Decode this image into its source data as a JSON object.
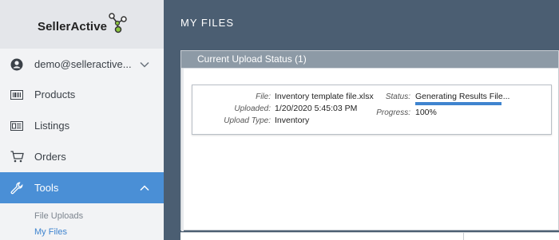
{
  "brand": {
    "name": "SellerActive",
    "logo_icon": "molecule-logo"
  },
  "sidebar": {
    "account": {
      "label": "demo@selleractive...",
      "icon": "user-icon"
    },
    "items": [
      {
        "label": "Products",
        "icon": "barcode-icon"
      },
      {
        "label": "Listings",
        "icon": "listings-icon"
      },
      {
        "label": "Orders",
        "icon": "cart-icon"
      },
      {
        "label": "Tools",
        "icon": "wrench-icon"
      }
    ],
    "sub_items": [
      {
        "label": "File Uploads"
      },
      {
        "label": "My Files"
      }
    ]
  },
  "main": {
    "title": "MY FILES",
    "panel_title": "Current Upload Status (1)",
    "upload": {
      "file_label": "File:",
      "file_value": "Inventory template file.xlsx",
      "uploaded_label": "Uploaded:",
      "uploaded_value": "1/20/2020 5:45:03 PM",
      "type_label": "Upload Type:",
      "type_value": "Inventory",
      "status_label": "Status:",
      "status_value": "Generating Results File...",
      "progress_label": "Progress:",
      "progress_value": "100%",
      "progress_fraction": 1.0
    }
  },
  "colors": {
    "accent": "#4a8fd6",
    "main_bg": "#4b5e72",
    "panel_header": "#8d9aa6"
  }
}
